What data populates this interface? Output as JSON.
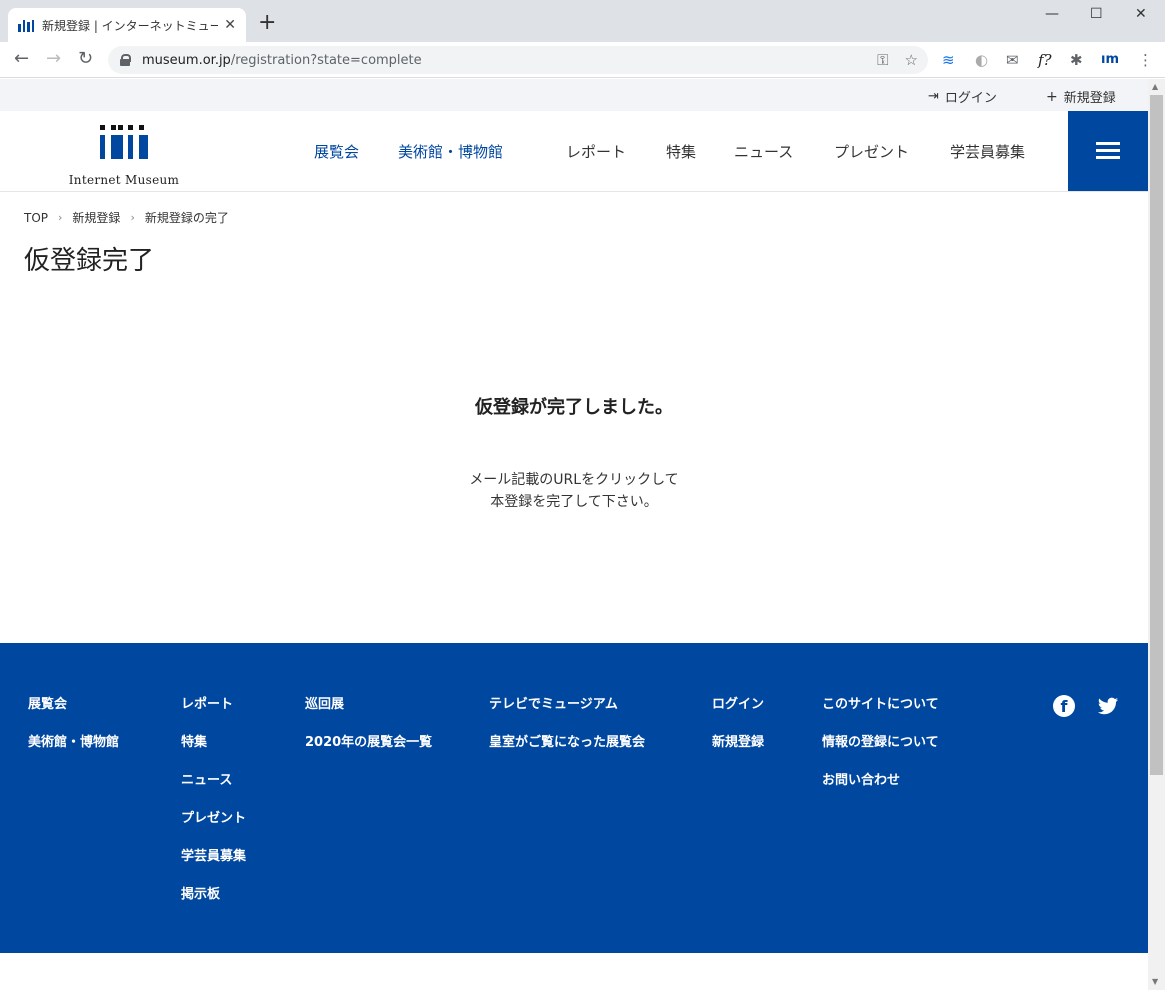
{
  "browser": {
    "tab_title": "新規登録 | インターネットミュージアム",
    "tab_close": "✕",
    "new_tab": "+",
    "url_host": "museum.or.jp",
    "url_path": "/registration?state=complete"
  },
  "utility": {
    "login_label": "ログイン",
    "register_label": "新規登録"
  },
  "logo": {
    "text": "Internet Museum"
  },
  "gnav": {
    "items": [
      "展覧会",
      "美術館・博物館",
      "レポート",
      "特集",
      "ニュース",
      "プレゼント",
      "学芸員募集"
    ]
  },
  "breadcrumb": {
    "items": [
      "TOP",
      "新規登録",
      "新規登録の完了"
    ]
  },
  "page": {
    "title": "仮登録完了",
    "heading": "仮登録が完了しました。",
    "message_line1": "メール記載のURLをクリックして",
    "message_line2": "本登録を完了して下さい。"
  },
  "footer": {
    "col1": [
      "展覧会",
      "美術館・博物館"
    ],
    "col2": [
      "レポート",
      "特集",
      "ニュース",
      "プレゼント",
      "学芸員募集",
      "掲示板"
    ],
    "col3": [
      "巡回展",
      "2020年の展覧会一覧"
    ],
    "col4": [
      "テレビでミュージアム",
      "皇室がご覧になった展覧会"
    ],
    "col5": [
      "ログイン",
      "新規登録"
    ],
    "col6": [
      "このサイトについて",
      "情報の登録について",
      "お問い合わせ"
    ]
  },
  "colors": {
    "brand_blue": "#0047a0",
    "utility_bg": "#f2f4f7"
  }
}
